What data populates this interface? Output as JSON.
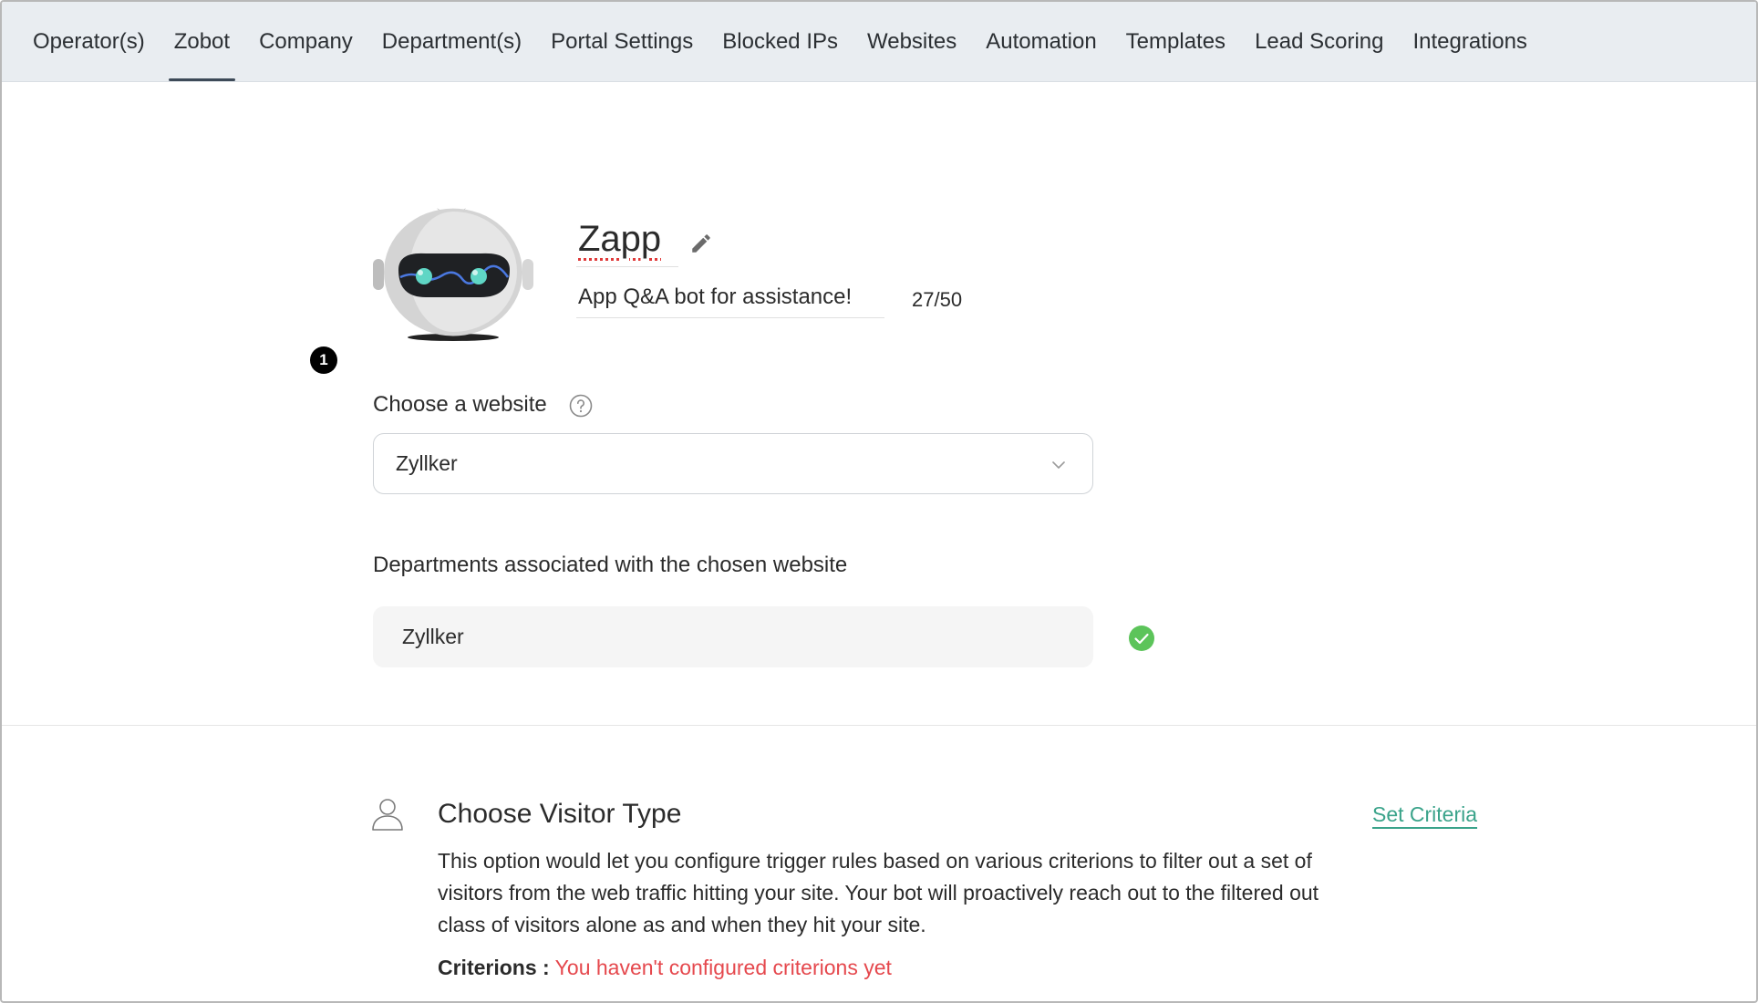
{
  "nav": {
    "tabs": [
      {
        "label": "Operator(s)"
      },
      {
        "label": "Zobot",
        "active": true
      },
      {
        "label": "Company"
      },
      {
        "label": "Department(s)"
      },
      {
        "label": "Portal Settings"
      },
      {
        "label": "Blocked IPs"
      },
      {
        "label": "Websites"
      },
      {
        "label": "Automation"
      },
      {
        "label": "Templates"
      },
      {
        "label": "Lead Scoring"
      },
      {
        "label": "Integrations"
      }
    ]
  },
  "bot": {
    "avatar_icon": "robot-avatar-icon",
    "name": "Zapp",
    "description": "App Q&A bot for assistance!",
    "char_count": "27/50",
    "step_badge": "1"
  },
  "website": {
    "label": "Choose a website",
    "selected": "Zyllker"
  },
  "departments": {
    "label": "Departments associated with the chosen website",
    "value": "Zyllker",
    "status_color": "#5cc45a"
  },
  "visitor": {
    "title": "Choose Visitor Type",
    "set_criteria_label": "Set Criteria",
    "description": "This option would let you configure trigger rules based on various criterions to filter out a set of visitors from the web traffic hitting your site. Your bot will proactively reach out to the filtered out class of visitors alone as and when they hit your site.",
    "criterions_label": "Criterions :",
    "criterions_value": "You haven't configured criterions yet"
  },
  "colors": {
    "accent_link": "#3aa38a",
    "error": "#e5484d",
    "nav_bg": "#e9edf1"
  }
}
